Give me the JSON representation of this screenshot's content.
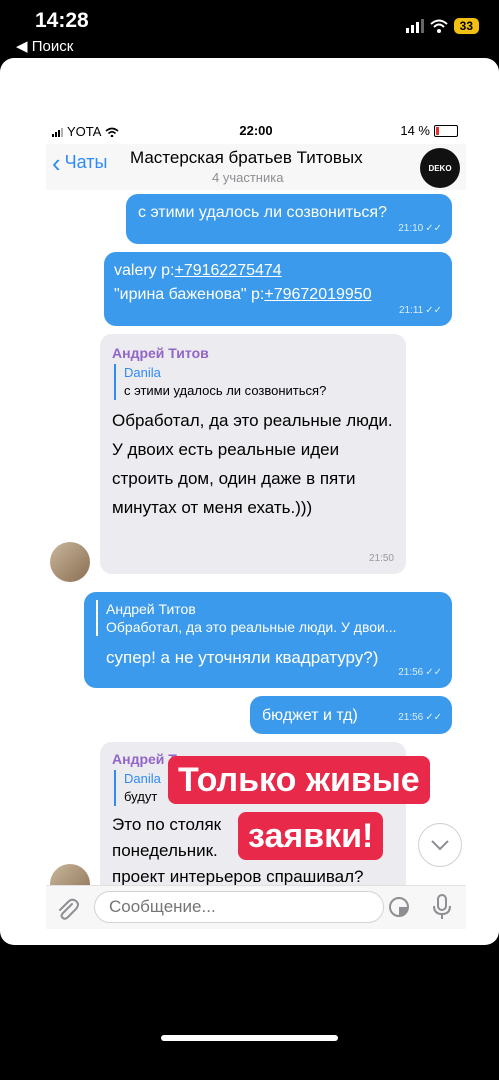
{
  "phone_status": {
    "time": "14:28",
    "back_label": "◀ Поиск",
    "battery": "33"
  },
  "inner_status": {
    "carrier": "YOTA",
    "time": "22:00",
    "battery_percent": "14 %"
  },
  "header": {
    "back_label": "Чаты",
    "title": "Мастерская братьев Титовых",
    "subtitle": "4 участника",
    "avatar_text": "DEKO"
  },
  "messages": {
    "m1": {
      "text": "с этими удалось ли созвониться?",
      "time": "21:10"
    },
    "m2": {
      "line1_prefix": "valery p:",
      "phone1": "+79162275474",
      "line2_prefix": "\"ирина баженова\" p:",
      "phone2": "+79672019950",
      "time": "21:11"
    },
    "m3": {
      "sender": "Андрей Титов",
      "reply_name": "Danila",
      "reply_text": "с этими удалось ли созвониться?",
      "text": "Обработал, да это реальные люди. У двоих есть реальные идеи строить дом, один даже в пяти минутах от меня ехать.)))",
      "time": "21:50"
    },
    "m4": {
      "reply_name": "Андрей Титов",
      "reply_text": "Обработал, да это реальные люди. У двои...",
      "text": "супер! а не уточняли квадратуру?)",
      "time": "21:56"
    },
    "m5": {
      "text": "бюджет и тд)",
      "time": "21:56"
    },
    "m6": {
      "sender": "Андрей Т",
      "reply_name": "Danila",
      "reply_text": "будут",
      "text_line1": "Это по столяк",
      "text_line2": "понедельник.",
      "text_line3": "проект интерьеров спрашивал?"
    }
  },
  "overlay": {
    "line1": "Только живые",
    "line2": "заявки!"
  },
  "composer": {
    "placeholder": "Сообщение..."
  },
  "colors": {
    "outgoing": "#3b9aeb",
    "incoming": "#ebebf0",
    "accent": "#2f8bf5",
    "sender": "#9265c9",
    "overlay": "#e8294a"
  }
}
